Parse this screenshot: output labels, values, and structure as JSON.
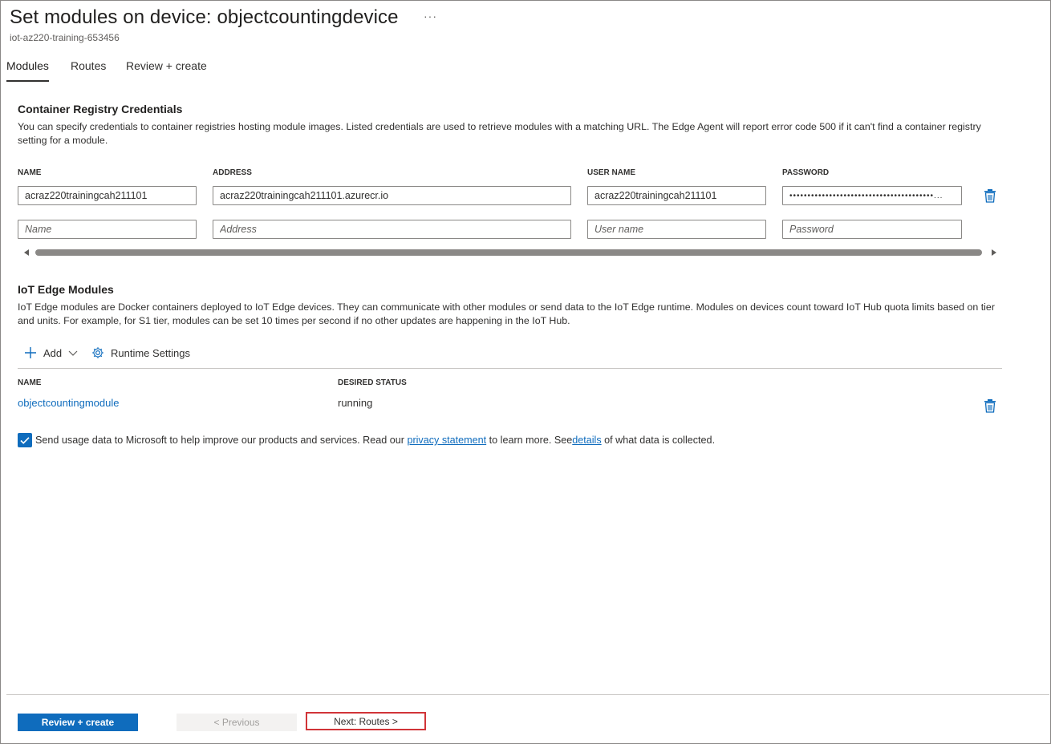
{
  "header": {
    "title": "Set modules on device: objectcountingdevice",
    "more_label": "···",
    "subtitle": "iot-az220-training-653456"
  },
  "tabs": [
    {
      "label": "Modules",
      "active": true
    },
    {
      "label": "Routes",
      "active": false
    },
    {
      "label": "Review + create",
      "active": false
    }
  ],
  "registry": {
    "heading": "Container Registry Credentials",
    "description": "You can specify credentials to container registries hosting module images. Listed credentials are used to retrieve modules with a matching URL. The Edge Agent will report error code 500 if it can't find a container registry setting for a module.",
    "columns": {
      "name": "NAME",
      "address": "ADDRESS",
      "user_name": "USER NAME",
      "password": "PASSWORD"
    },
    "row": {
      "name": "acraz220trainingcah211101",
      "address": "acraz220trainingcah211101.azurecr.io",
      "user_name": "acraz220trainingcah211101",
      "password": "••••••••••••••••••••••••••••••••••••••••..."
    },
    "placeholders": {
      "name": "Name",
      "address": "Address",
      "user_name": "User name",
      "password": "Password"
    }
  },
  "modules": {
    "heading": "IoT Edge Modules",
    "description": "IoT Edge modules are Docker containers deployed to IoT Edge devices. They can communicate with other modules or send data to the IoT Edge runtime. Modules on devices count toward IoT Hub quota limits based on tier and units. For example, for S1 tier, modules can be set 10 times per second if no other updates are happening in the IoT Hub.",
    "add_label": "Add",
    "runtime_label": "Runtime Settings",
    "columns": {
      "name": "NAME",
      "desired_status": "DESIRED STATUS"
    },
    "rows": [
      {
        "name": "objectcountingmodule",
        "status": "running"
      }
    ]
  },
  "consent": {
    "checked": true,
    "text_before": "Send usage data to Microsoft to help improve our products and services. Read our ",
    "privacy_link": "privacy statement",
    "text_middle": " to learn more. See",
    "details_link": "details",
    "text_after": " of what data is collected."
  },
  "footer": {
    "review_create": "Review + create",
    "previous": "< Previous",
    "next": "Next: Routes  >"
  },
  "colors": {
    "accent": "#0f6cbd",
    "highlight_border": "#d13438"
  }
}
